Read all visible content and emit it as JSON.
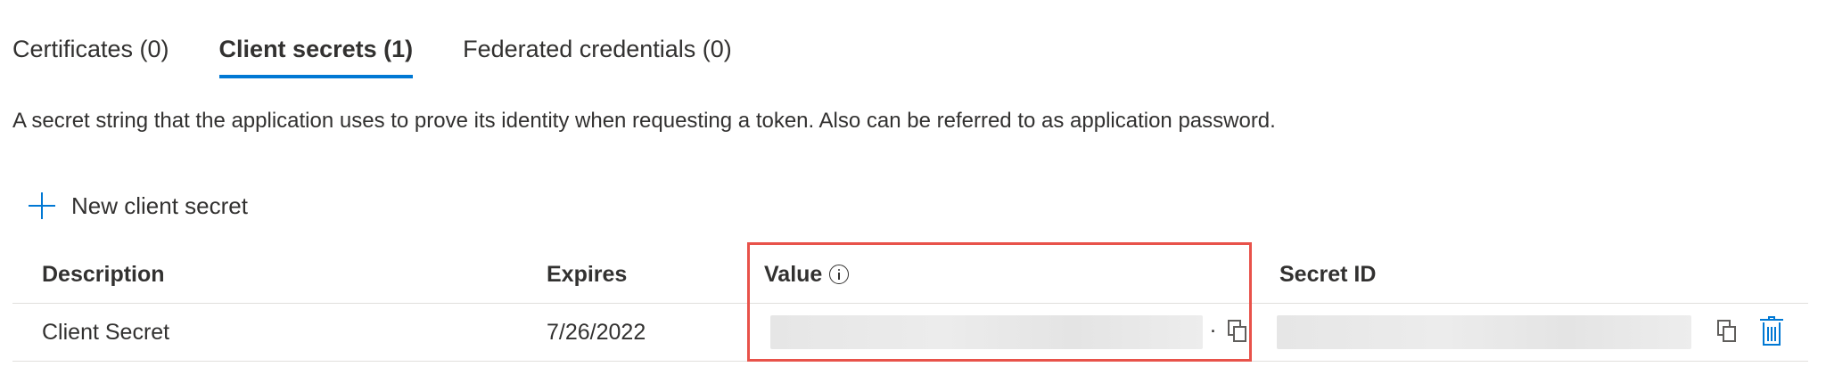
{
  "tabs": [
    {
      "label": "Certificates (0)",
      "active": false
    },
    {
      "label": "Client secrets (1)",
      "active": true
    },
    {
      "label": "Federated credentials (0)",
      "active": false
    }
  ],
  "description": "A secret string that the application uses to prove its identity when requesting a token. Also can be referred to as application password.",
  "toolbar": {
    "new_secret_label": "New client secret",
    "new_secret_icon": "plus-icon"
  },
  "table": {
    "headers": {
      "description": "Description",
      "expires": "Expires",
      "value": "Value",
      "secret_id": "Secret ID"
    },
    "rows": [
      {
        "description": "Client Secret",
        "expires": "7/26/2022",
        "value_trailing": "."
      }
    ]
  },
  "colors": {
    "accent": "#0078d4",
    "highlight": "#e8524a",
    "text": "#323130",
    "divider": "#e1dfdd"
  }
}
